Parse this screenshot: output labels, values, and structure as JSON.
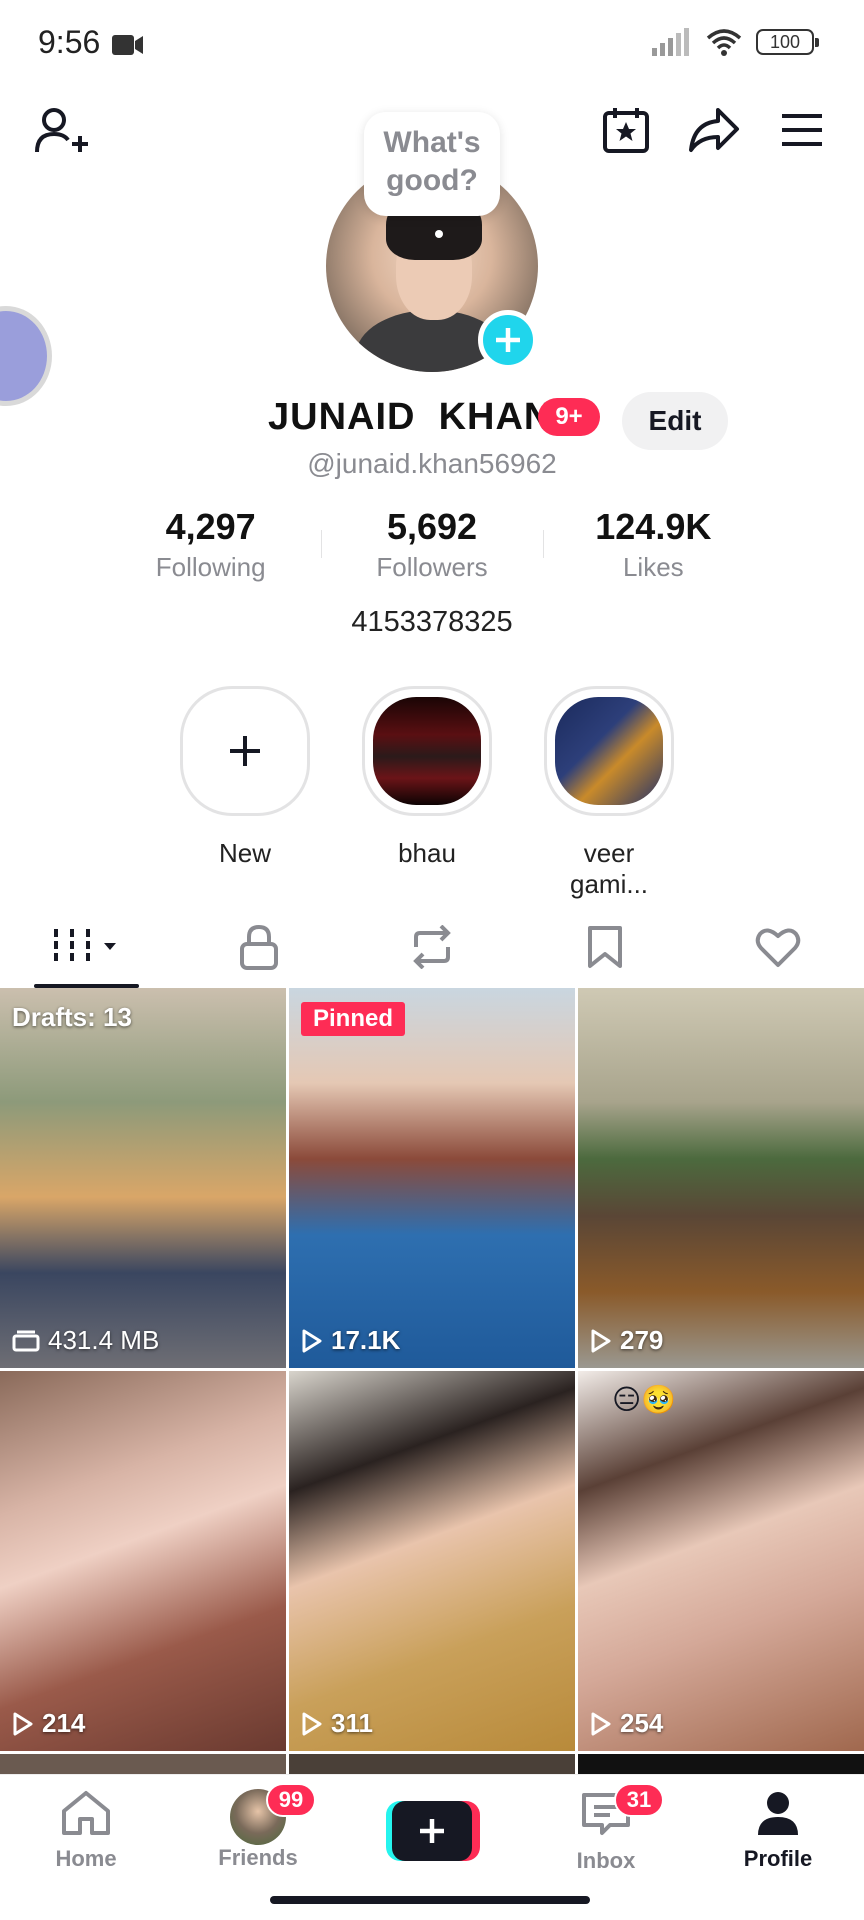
{
  "status_bar": {
    "time": "9:56",
    "battery": "100"
  },
  "profile": {
    "bubble_text_line1": "What's",
    "bubble_text_line2": "good?",
    "display_name": "JUNAID  KHAN",
    "notification_badge": "9+",
    "edit_label": "Edit",
    "handle": "@junaid.khan56962",
    "bio": "4153378325",
    "stats": [
      {
        "value": "4,297",
        "label": "Following"
      },
      {
        "value": "5,692",
        "label": "Followers"
      },
      {
        "value": "124.9K",
        "label": "Likes"
      }
    ]
  },
  "highlights": [
    {
      "label": "New"
    },
    {
      "label": "bhau"
    },
    {
      "label": "veer gami..."
    }
  ],
  "tabs": [
    {
      "icon": "videos-grid-icon"
    },
    {
      "icon": "lock-icon"
    },
    {
      "icon": "repost-icon"
    },
    {
      "icon": "bookmark-icon"
    },
    {
      "icon": "heart-icon"
    }
  ],
  "videos": [
    {
      "top_label": "Drafts: 13",
      "bottom_label": "431.4 MB",
      "kind": "drafts"
    },
    {
      "top_label": "Pinned",
      "bottom_label": "17.1K",
      "kind": "pinned"
    },
    {
      "top_label": "",
      "bottom_label": "279",
      "kind": "normal"
    },
    {
      "top_label": "",
      "bottom_label": "214",
      "kind": "normal"
    },
    {
      "top_label": "",
      "bottom_label": "311",
      "kind": "normal"
    },
    {
      "top_label": "😑🥹",
      "bottom_label": "254",
      "kind": "normal"
    }
  ],
  "nav": {
    "home": "Home",
    "friends": "Friends",
    "friends_badge": "99",
    "inbox": "Inbox",
    "inbox_badge": "31",
    "profile": "Profile"
  },
  "colors": {
    "accent": "#fe2c55",
    "cyan": "#25f4ee",
    "avatar_plus": "#20d5ec"
  }
}
